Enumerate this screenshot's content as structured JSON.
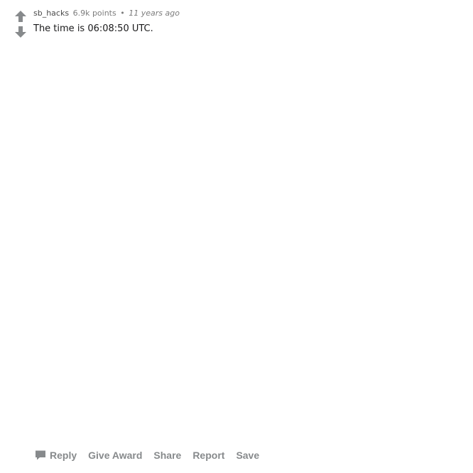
{
  "comment": {
    "author": "sb_hacks",
    "points": "6.9k points",
    "separator": "•",
    "time": "11 years ago",
    "body": "The time is 06:08:50 UTC."
  },
  "vote": {
    "upvote_icon": "arrow-up-icon",
    "downvote_icon": "arrow-down-icon",
    "icon_color": "#878a8c"
  },
  "actions": {
    "reply_icon": "comment-bubble-icon",
    "reply": "Reply",
    "give_award": "Give Award",
    "share": "Share",
    "report": "Report",
    "save": "Save"
  }
}
